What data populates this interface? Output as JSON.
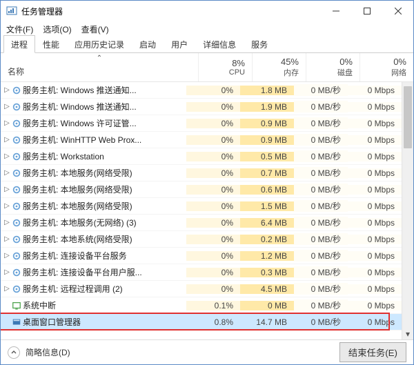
{
  "window": {
    "title": "任务管理器"
  },
  "menu": {
    "file": "文件(F)",
    "options": "选项(O)",
    "view": "查看(V)"
  },
  "tabs": [
    "进程",
    "性能",
    "应用历史记录",
    "启动",
    "用户",
    "详细信息",
    "服务"
  ],
  "active_tab": 0,
  "columns": {
    "name": "名称",
    "cols": [
      {
        "pct": "8%",
        "label": "CPU"
      },
      {
        "pct": "45%",
        "label": "内存"
      },
      {
        "pct": "0%",
        "label": "磁盘"
      },
      {
        "pct": "0%",
        "label": "网络"
      }
    ]
  },
  "rows": [
    {
      "exp": true,
      "icon": "gear",
      "name": "服务主机: Windows 推送通知...",
      "cpu": "0%",
      "mem": "1.8 MB",
      "disk": "0 MB/秒",
      "net": "0 Mbps"
    },
    {
      "exp": true,
      "icon": "gear",
      "name": "服务主机: Windows 推送通知...",
      "cpu": "0%",
      "mem": "1.9 MB",
      "disk": "0 MB/秒",
      "net": "0 Mbps"
    },
    {
      "exp": true,
      "icon": "gear",
      "name": "服务主机: Windows 许可证管...",
      "cpu": "0%",
      "mem": "0.9 MB",
      "disk": "0 MB/秒",
      "net": "0 Mbps"
    },
    {
      "exp": true,
      "icon": "gear",
      "name": "服务主机: WinHTTP Web Prox...",
      "cpu": "0%",
      "mem": "0.9 MB",
      "disk": "0 MB/秒",
      "net": "0 Mbps"
    },
    {
      "exp": true,
      "icon": "gear",
      "name": "服务主机: Workstation",
      "cpu": "0%",
      "mem": "0.5 MB",
      "disk": "0 MB/秒",
      "net": "0 Mbps"
    },
    {
      "exp": true,
      "icon": "gear",
      "name": "服务主机: 本地服务(网络受限)",
      "cpu": "0%",
      "mem": "0.7 MB",
      "disk": "0 MB/秒",
      "net": "0 Mbps"
    },
    {
      "exp": true,
      "icon": "gear",
      "name": "服务主机: 本地服务(网络受限)",
      "cpu": "0%",
      "mem": "0.6 MB",
      "disk": "0 MB/秒",
      "net": "0 Mbps"
    },
    {
      "exp": true,
      "icon": "gear",
      "name": "服务主机: 本地服务(网络受限)",
      "cpu": "0%",
      "mem": "1.5 MB",
      "disk": "0 MB/秒",
      "net": "0 Mbps"
    },
    {
      "exp": true,
      "icon": "gear",
      "name": "服务主机: 本地服务(无网络)  (3)",
      "cpu": "0%",
      "mem": "6.4 MB",
      "disk": "0 MB/秒",
      "net": "0 Mbps"
    },
    {
      "exp": true,
      "icon": "gear",
      "name": "服务主机: 本地系统(网络受限)",
      "cpu": "0%",
      "mem": "0.2 MB",
      "disk": "0 MB/秒",
      "net": "0 Mbps"
    },
    {
      "exp": true,
      "icon": "gear",
      "name": "服务主机: 连接设备平台服务",
      "cpu": "0%",
      "mem": "1.2 MB",
      "disk": "0 MB/秒",
      "net": "0 Mbps"
    },
    {
      "exp": true,
      "icon": "gear",
      "name": "服务主机: 连接设备平台用户服...",
      "cpu": "0%",
      "mem": "0.3 MB",
      "disk": "0 MB/秒",
      "net": "0 Mbps"
    },
    {
      "exp": true,
      "icon": "gear",
      "name": "服务主机: 远程过程调用  (2)",
      "cpu": "0%",
      "mem": "4.5 MB",
      "disk": "0 MB/秒",
      "net": "0 Mbps"
    },
    {
      "exp": false,
      "icon": "sys",
      "name": "系统中断",
      "cpu": "0.1%",
      "mem": "0 MB",
      "disk": "0 MB/秒",
      "net": "0 Mbps"
    },
    {
      "exp": false,
      "icon": "dwm",
      "name": "桌面窗口管理器",
      "cpu": "0.8%",
      "mem": "14.7 MB",
      "disk": "0 MB/秒",
      "net": "0 Mbps",
      "selected": true,
      "highlight": true
    }
  ],
  "footer": {
    "fewer": "简略信息(D)",
    "end_task": "结束任务(E)"
  }
}
